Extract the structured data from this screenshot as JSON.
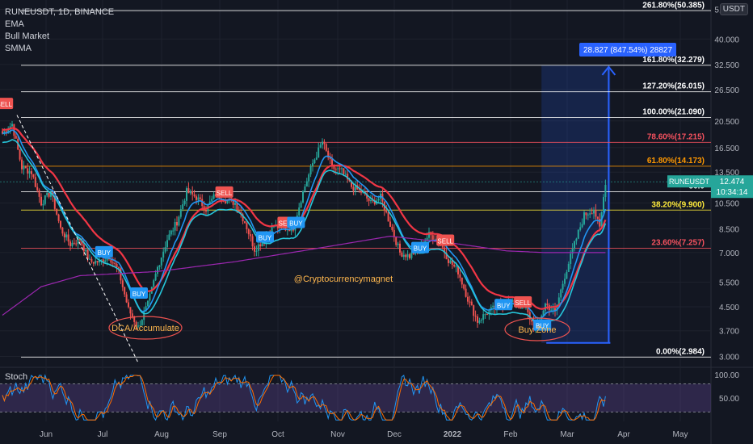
{
  "legend": {
    "symbol": "RUNEUSDT, 1D, BINANCE",
    "indicators": [
      "EMA",
      "Bull Market",
      "SMMA"
    ]
  },
  "currency_badge": "USDT",
  "stoch_label": "Stoch",
  "watermark": "@Cryptocurrencymagnet",
  "price_tag": {
    "symbol": "RUNEUSDT",
    "price": "12.474",
    "countdown": "10:34:14"
  },
  "measure_label": "28.827 (847.54%) 28827",
  "zones": {
    "left": "DCA/Accumulate",
    "right": "Buy Zone"
  },
  "colors": {
    "background": "#131722",
    "up": "#26a69a",
    "down": "#ef5350",
    "ema_fast": "#2196f3",
    "ema_red": "#f23645",
    "bull_market": "#26c6da",
    "smma": "#9c27b0",
    "fib_line": "#ffffff",
    "fib_orange": "#ff9800",
    "fib_red": "#f7525f",
    "measure": "#2962ff"
  },
  "chart_data": {
    "type": "candlestick",
    "scale": "log",
    "ylim": [
      2.8,
      55
    ],
    "y_ticks": [
      "51.000",
      "40.000",
      "32.500",
      "26.500",
      "20.500",
      "16.500",
      "13.500",
      "10.500",
      "8.500",
      "7.000",
      "5.500",
      "4.500",
      "3.700",
      "3.000"
    ],
    "x_ticks": [
      "Jun",
      "Jul",
      "Aug",
      "Sep",
      "Oct",
      "Nov",
      "Dec",
      "2022",
      "Feb",
      "Mar",
      "Apr",
      "May"
    ],
    "fib_levels": [
      {
        "label": "0.00%(2.984)",
        "value": 2.984,
        "color": "#ffffff"
      },
      {
        "label": "23.60%(7.257)",
        "value": 7.257,
        "color": "#f7525f"
      },
      {
        "label": "38.20%(9.900)",
        "value": 9.9,
        "color": "#ffeb3b"
      },
      {
        "label": "50.0",
        "value": 11.5,
        "color": "#ffffff"
      },
      {
        "label": "61.80%(14.173)",
        "value": 14.173,
        "color": "#ff9800"
      },
      {
        "label": "78.60%(17.215)",
        "value": 17.215,
        "color": "#f7525f"
      },
      {
        "label": "100.00%(21.090)",
        "value": 21.09,
        "color": "#ffffff"
      },
      {
        "label": "127.20%(26.015)",
        "value": 26.015,
        "color": "#ffffff"
      },
      {
        "label": "161.80%(32.279)",
        "value": 32.279,
        "color": "#ffffff"
      },
      {
        "label": "261.80%(50.385)",
        "value": 50.385,
        "color": "#ffffff"
      }
    ],
    "signals": [
      {
        "label": "SELL",
        "t": 0.5,
        "price": 23.5
      },
      {
        "label": "BUY",
        "t": 52,
        "price": 7.0
      },
      {
        "label": "BUY",
        "t": 70,
        "price": 5.0
      },
      {
        "label": "SELL",
        "t": 114,
        "price": 11.4
      },
      {
        "label": "BUY",
        "t": 135,
        "price": 7.9
      },
      {
        "label": "SELL",
        "t": 146,
        "price": 8.9
      },
      {
        "label": "BUY",
        "t": 151,
        "price": 8.9
      },
      {
        "label": "BUY",
        "t": 215,
        "price": 7.25
      },
      {
        "label": "SELL",
        "t": 228,
        "price": 7.7
      },
      {
        "label": "BUY",
        "t": 258,
        "price": 4.55
      },
      {
        "label": "SELL",
        "t": 268,
        "price": 4.65
      },
      {
        "label": "BUY",
        "t": 278,
        "price": 3.85
      }
    ],
    "close_anchors": [
      [
        0,
        18.5
      ],
      [
        5,
        20
      ],
      [
        10,
        14
      ],
      [
        15,
        13.5
      ],
      [
        20,
        10.5
      ],
      [
        25,
        11.5
      ],
      [
        30,
        8.5
      ],
      [
        35,
        7.5
      ],
      [
        40,
        7.8
      ],
      [
        45,
        6.5
      ],
      [
        50,
        6.5
      ],
      [
        55,
        6.8
      ],
      [
        60,
        6.0
      ],
      [
        65,
        4.4
      ],
      [
        70,
        3.8
      ],
      [
        75,
        4.6
      ],
      [
        80,
        6.2
      ],
      [
        85,
        7.8
      ],
      [
        90,
        9.0
      ],
      [
        95,
        11.5
      ],
      [
        100,
        11.0
      ],
      [
        105,
        10.0
      ],
      [
        110,
        11.3
      ],
      [
        115,
        10.8
      ],
      [
        120,
        10.5
      ],
      [
        125,
        9.0
      ],
      [
        130,
        7.2
      ],
      [
        135,
        7.8
      ],
      [
        140,
        8.7
      ],
      [
        145,
        8.5
      ],
      [
        150,
        8.6
      ],
      [
        155,
        11.5
      ],
      [
        160,
        14.5
      ],
      [
        165,
        17.3
      ],
      [
        170,
        14.0
      ],
      [
        175,
        13.6
      ],
      [
        180,
        12.0
      ],
      [
        185,
        11.5
      ],
      [
        190,
        10.5
      ],
      [
        195,
        11.0
      ],
      [
        200,
        8.8
      ],
      [
        205,
        7.0
      ],
      [
        210,
        6.8
      ],
      [
        215,
        7.3
      ],
      [
        220,
        8.1
      ],
      [
        225,
        7.8
      ],
      [
        230,
        6.6
      ],
      [
        235,
        6.0
      ],
      [
        240,
        4.8
      ],
      [
        245,
        4.0
      ],
      [
        250,
        4.3
      ],
      [
        255,
        4.5
      ],
      [
        260,
        4.7
      ],
      [
        265,
        4.6
      ],
      [
        270,
        4.4
      ],
      [
        275,
        3.7
      ],
      [
        280,
        4.6
      ],
      [
        285,
        4.3
      ],
      [
        290,
        5.8
      ],
      [
        295,
        7.5
      ],
      [
        300,
        9.5
      ],
      [
        305,
        10.0
      ],
      [
        308,
        8.5
      ],
      [
        311,
        12.5
      ]
    ],
    "smma_anchors": [
      [
        0,
        4.2
      ],
      [
        20,
        5.3
      ],
      [
        40,
        5.8
      ],
      [
        80,
        6.0
      ],
      [
        120,
        6.5
      ],
      [
        160,
        7.2
      ],
      [
        200,
        8.0
      ],
      [
        230,
        7.6
      ],
      [
        260,
        7.1
      ],
      [
        280,
        7.0
      ],
      [
        311,
        7.0
      ]
    ],
    "measure": {
      "start_t": 278,
      "end_t": 311,
      "from": 3.35,
      "to": 32.279
    },
    "stoch": {
      "ylim": [
        0,
        110
      ],
      "y_ticks": [
        "100.00",
        "50.00"
      ],
      "bands": [
        20,
        80
      ]
    }
  }
}
